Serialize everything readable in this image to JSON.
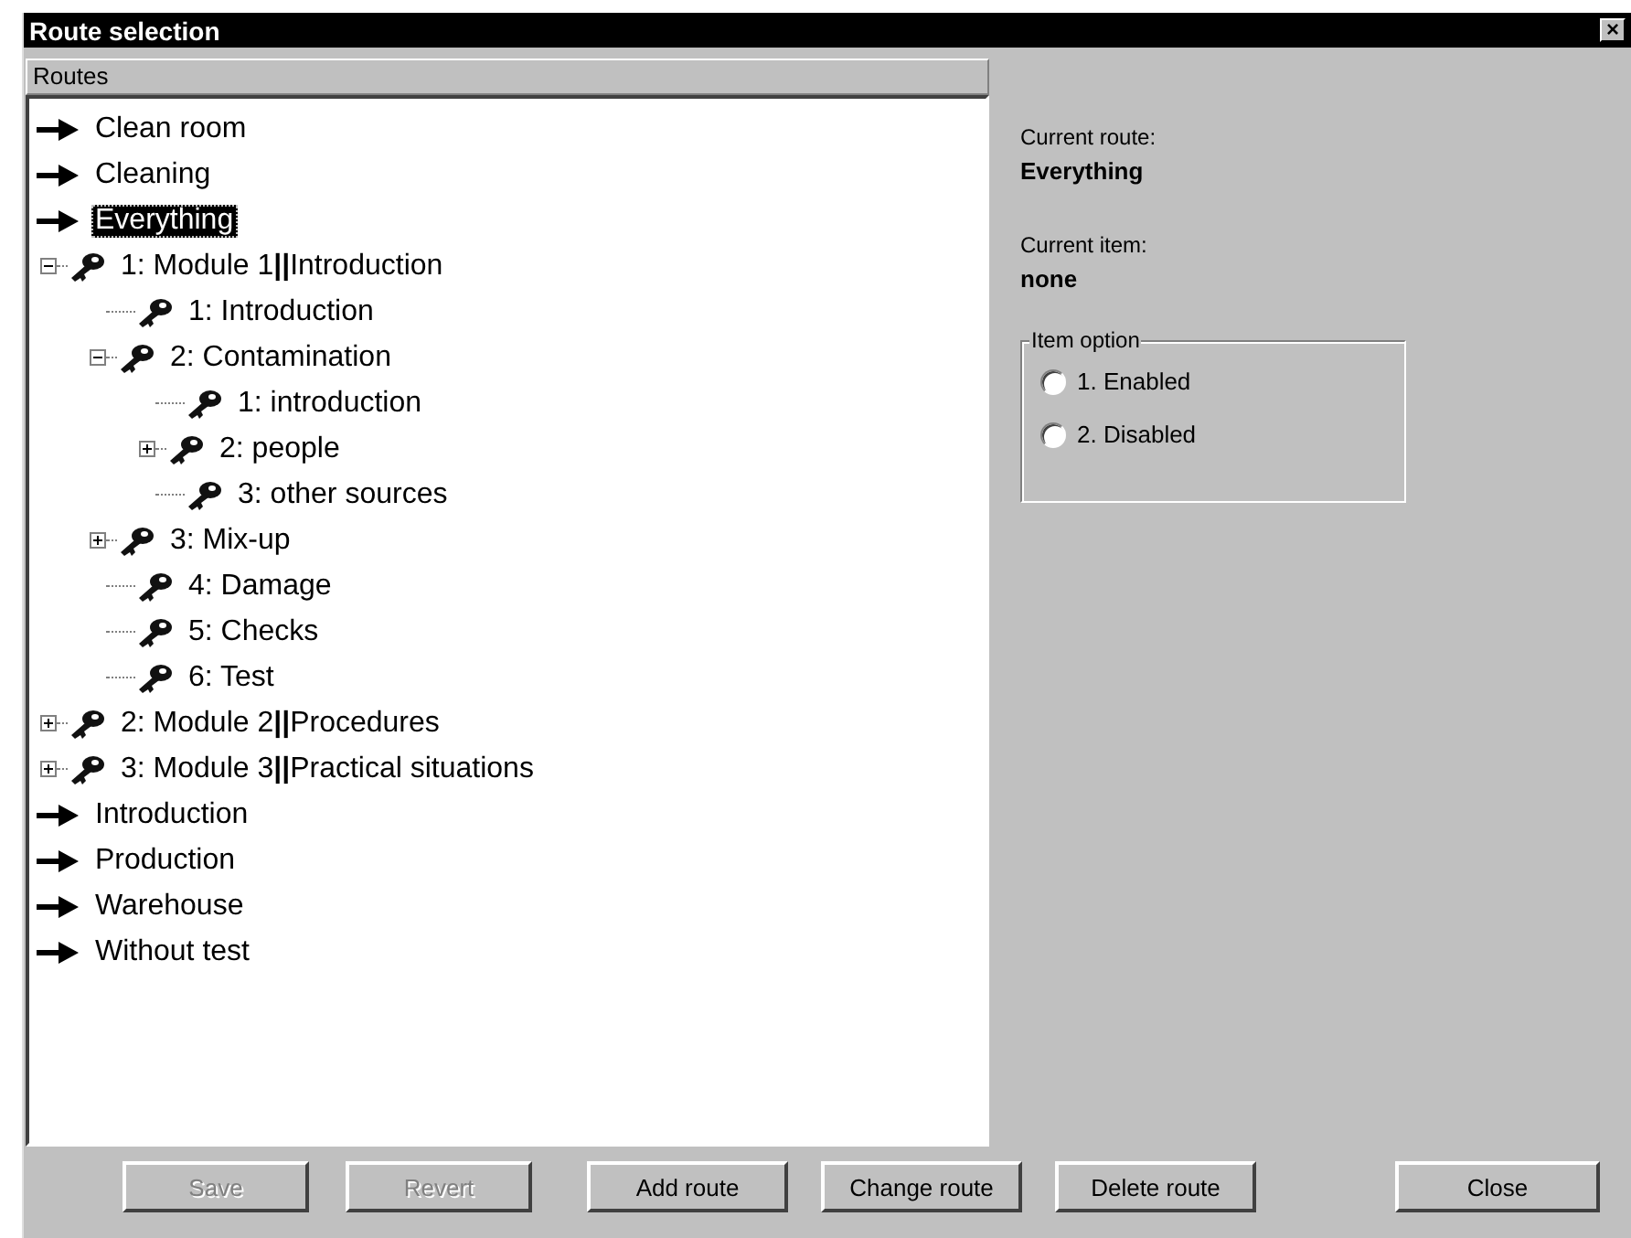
{
  "window": {
    "title": "Route selection",
    "close": "×"
  },
  "routes_header": "Routes",
  "tree": [
    {
      "label": "Clean room",
      "kind": "route",
      "selected": false
    },
    {
      "label": "Cleaning",
      "kind": "route",
      "selected": false
    },
    {
      "label": "Everything",
      "kind": "route",
      "selected": true
    },
    {
      "label": "1: Module 1**||**Introduction",
      "kind": "module",
      "selected": false,
      "expanded": true,
      "children": [
        {
          "label": "1: Introduction",
          "kind": "module",
          "selected": false
        },
        {
          "label": "2: Contamination",
          "kind": "module",
          "selected": false,
          "expanded": true,
          "children": [
            {
              "label": "1: introduction",
              "kind": "module",
              "selected": false
            },
            {
              "label": "2: people",
              "kind": "module",
              "selected": false,
              "expanded": false
            },
            {
              "label": "3: other sources",
              "kind": "module",
              "selected": false
            }
          ]
        },
        {
          "label": "3: Mix-up",
          "kind": "module",
          "selected": false,
          "expanded": false
        },
        {
          "label": "4: Damage",
          "kind": "module",
          "selected": false
        },
        {
          "label": "5: Checks",
          "kind": "module",
          "selected": false
        },
        {
          "label": "6: Test",
          "kind": "module",
          "selected": false
        }
      ]
    },
    {
      "label": "2: Module 2**||**Procedures",
      "kind": "module",
      "selected": false,
      "expanded": false
    },
    {
      "label": "3: Module 3**||**Practical situations",
      "kind": "module",
      "selected": false,
      "expanded": false
    },
    {
      "label": "Introduction",
      "kind": "route",
      "selected": false
    },
    {
      "label": "Production",
      "kind": "route",
      "selected": false
    },
    {
      "label": "Warehouse",
      "kind": "route",
      "selected": false
    },
    {
      "label": "Without test",
      "kind": "route",
      "selected": false
    }
  ],
  "info": [
    {
      "label": "Current route:",
      "value": "Everything"
    },
    {
      "label": "Current item:",
      "value": "none"
    }
  ],
  "item_option": {
    "legend": "Item option",
    "options": [
      {
        "label": "1. Enabled",
        "selected": false
      },
      {
        "label": "2. Disabled",
        "selected": false
      }
    ]
  },
  "buttons": [
    {
      "label": "Save",
      "disabled": true
    },
    {
      "label": "Revert",
      "disabled": true
    },
    {
      "label": "Add route",
      "disabled": false
    },
    {
      "label": "Change route",
      "disabled": false
    },
    {
      "label": "Delete route",
      "disabled": false
    },
    {
      "label": "Close",
      "disabled": false
    }
  ]
}
